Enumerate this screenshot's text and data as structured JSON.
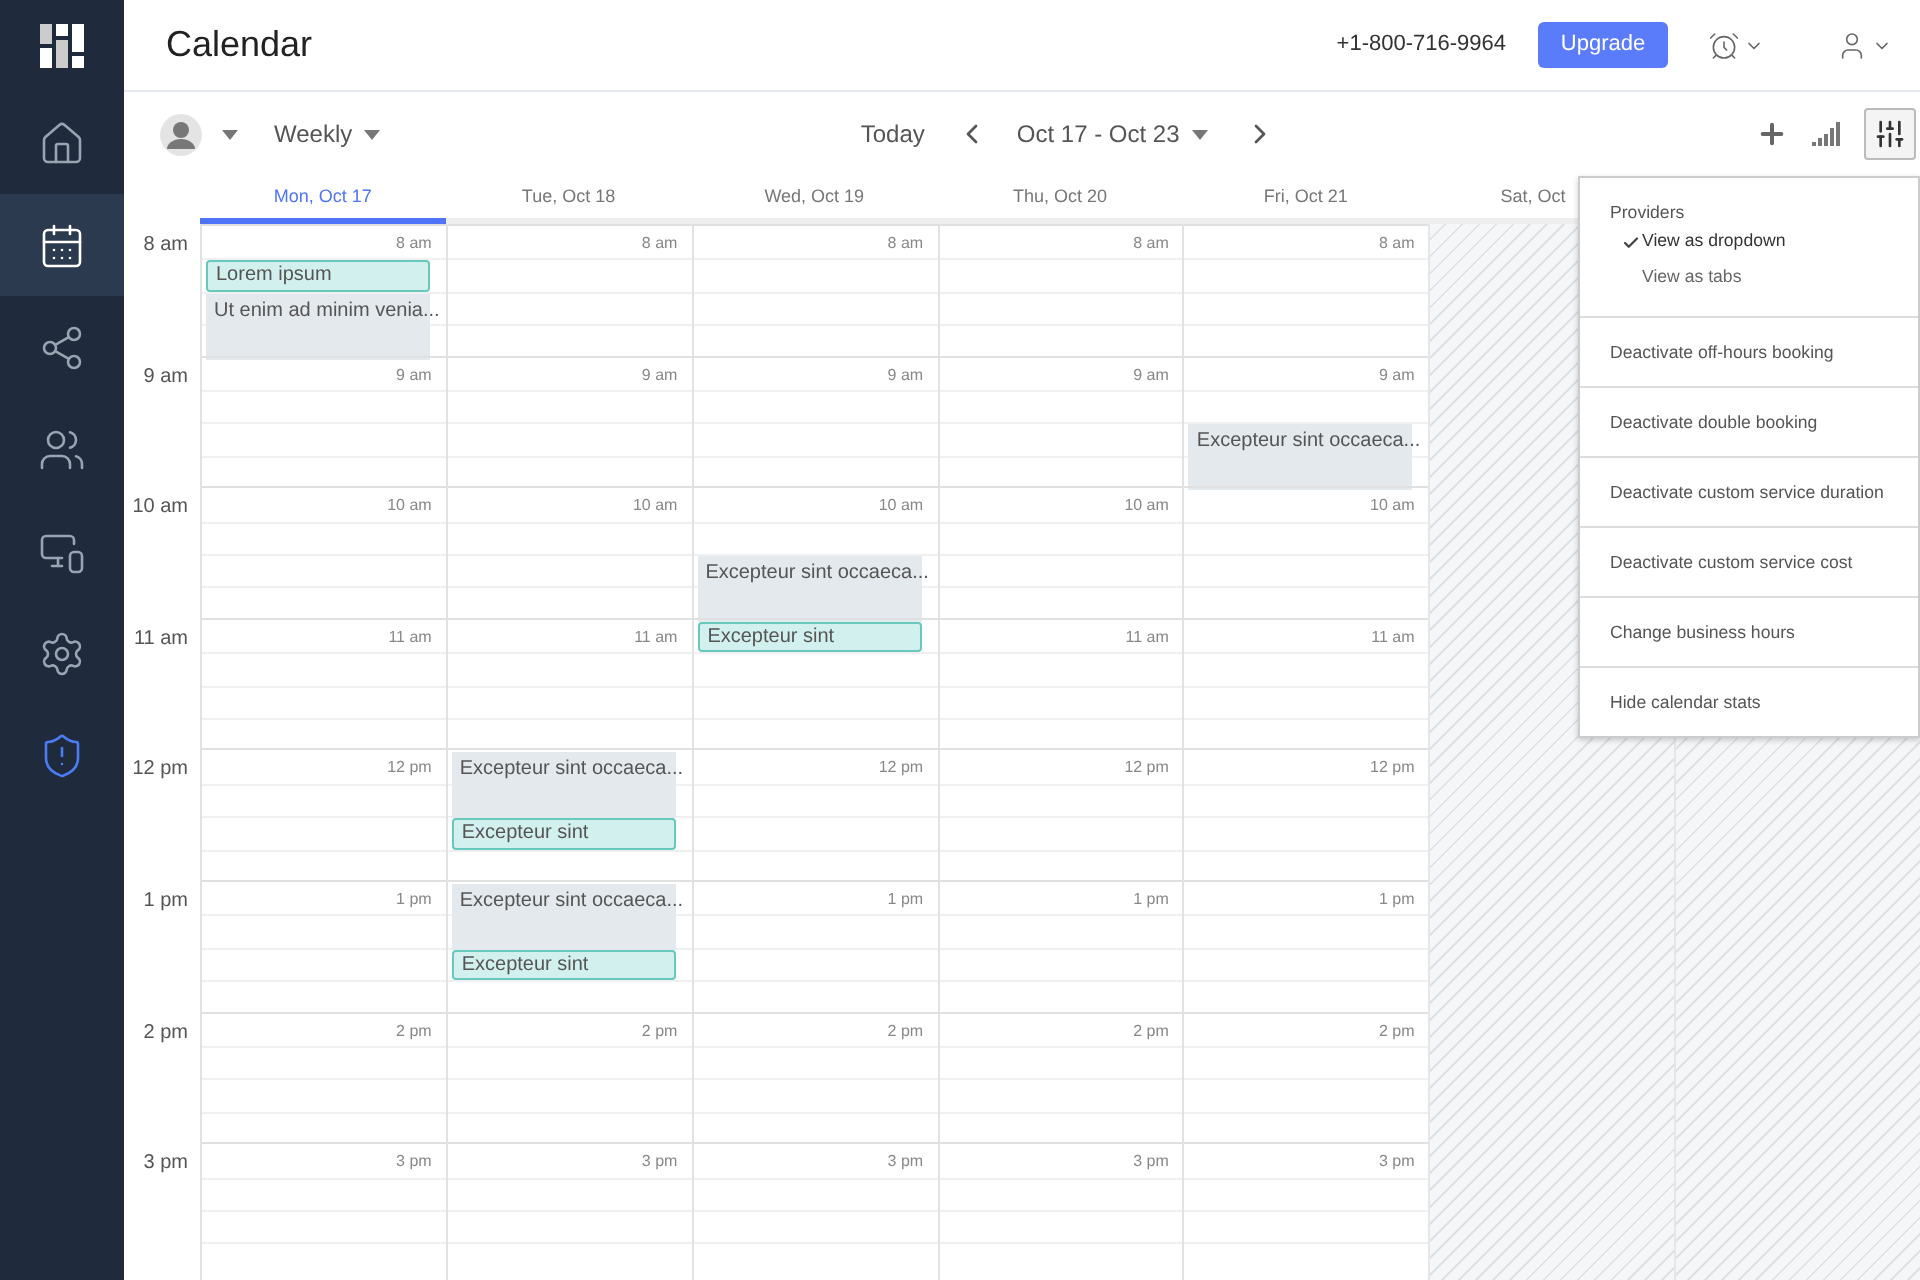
{
  "sidebar": {
    "items": [
      {
        "selected": false
      },
      {
        "selected": true
      },
      {
        "selected": false
      },
      {
        "selected": false
      },
      {
        "selected": false
      },
      {
        "selected": false
      },
      {
        "selected": false
      }
    ]
  },
  "header": {
    "title": "Calendar",
    "phone": "+1-800-716-9964",
    "upgrade": "Upgrade"
  },
  "toolbar": {
    "view": "Weekly",
    "today": "Today",
    "range": "Oct 17 - Oct 23",
    "settings_open": true
  },
  "days": [
    {
      "header": "Mon, Oct 17",
      "selected": true,
      "closed": false
    },
    {
      "header": "Tue, Oct 18",
      "selected": false,
      "closed": false
    },
    {
      "header": "Wed, Oct 19",
      "selected": false,
      "closed": false
    },
    {
      "header": "Thu, Oct 20",
      "selected": false,
      "closed": false
    },
    {
      "header": "Fri, Oct 21",
      "selected": false,
      "closed": false
    },
    {
      "header": "Sat, Oct",
      "selected": false,
      "closed": true
    },
    {
      "closed": true
    }
  ],
  "hours": [
    {
      "label": "8 am",
      "cells": [
        {
          "label": "8 am",
          "events": [
            {
              "kind": "gap"
            },
            {
              "text": "Lorem ipsum",
              "kind": "booked"
            },
            {
              "text": "Ut enim ad minim venia...",
              "kind": "busy"
            }
          ]
        },
        {
          "label": "8 am"
        },
        {
          "label": "8 am"
        },
        {
          "label": "8 am"
        },
        {
          "label": "8 am"
        }
      ]
    },
    {
      "label": "9 am",
      "cells": [
        {
          "label": "9 am"
        },
        {
          "label": "9 am"
        },
        {
          "label": "9 am"
        },
        {
          "label": "9 am"
        },
        {
          "label": "9 am",
          "events": [
            {
              "kind": "gap"
            },
            {
              "kind": "gap"
            },
            {
              "text": "Excepteur sint occaeca...",
              "kind": "busy"
            }
          ]
        }
      ]
    },
    {
      "label": "10 am",
      "cells": [
        {
          "label": "10 am"
        },
        {
          "label": "10 am"
        },
        {
          "label": "10 am",
          "events": [
            {
              "kind": "gap"
            },
            {
              "kind": "gap"
            },
            {
              "text": "Excepteur sint occaeca...",
              "kind": "busy"
            }
          ]
        },
        {
          "label": "10 am"
        },
        {
          "label": "10 am"
        }
      ]
    },
    {
      "label": "11 am",
      "cells": [
        {
          "label": "11 am"
        },
        {
          "label": "11 am"
        },
        {
          "events": [
            {
              "text": "Excepteur sint",
              "kind": "booked"
            }
          ]
        },
        {
          "label": "11 am"
        },
        {
          "label": "11 am"
        }
      ]
    },
    {
      "label": "12 pm",
      "cells": [
        {
          "label": "12 pm"
        },
        {
          "events": [
            {
              "text": "Excepteur sint occaeca...",
              "kind": "busy"
            },
            {
              "text": "Excepteur sint",
              "kind": "booked"
            }
          ]
        },
        {
          "label": "12 pm"
        },
        {
          "label": "12 pm"
        },
        {
          "label": "12 pm"
        }
      ]
    },
    {
      "label": "1 pm",
      "cells": [
        {
          "label": "1 pm"
        },
        {
          "events": [
            {
              "text": "Excepteur sint occaeca...",
              "kind": "busy"
            },
            {
              "text": "Excepteur sint",
              "kind": "booked"
            }
          ]
        },
        {
          "label": "1 pm"
        },
        {
          "label": "1 pm"
        },
        {
          "label": "1 pm"
        }
      ]
    },
    {
      "label": "2 pm",
      "cells": [
        {
          "label": "2 pm"
        },
        {
          "label": "2 pm"
        },
        {
          "label": "2 pm"
        },
        {
          "label": "2 pm"
        },
        {
          "label": "2 pm"
        }
      ]
    },
    {
      "label": "3 pm",
      "cells": [
        {
          "label": "3 pm"
        },
        {
          "label": "3 pm"
        },
        {
          "label": "3 pm"
        },
        {
          "label": "3 pm"
        },
        {
          "label": "3 pm"
        }
      ]
    }
  ],
  "menu": {
    "sections": [
      {
        "title": "Providers",
        "options": [
          {
            "label": "View as dropdown",
            "selected": true
          },
          {
            "label": "View as tabs",
            "selected": false
          }
        ]
      },
      {
        "items": [
          "Deactivate off-hours booking"
        ]
      },
      {
        "items": [
          "Deactivate double booking"
        ]
      },
      {
        "items": [
          "Deactivate custom service duration"
        ]
      },
      {
        "items": [
          "Deactivate custom service cost"
        ]
      },
      {
        "items": [
          "Change business hours"
        ]
      },
      {
        "items": [
          "Hide calendar stats"
        ]
      }
    ]
  }
}
